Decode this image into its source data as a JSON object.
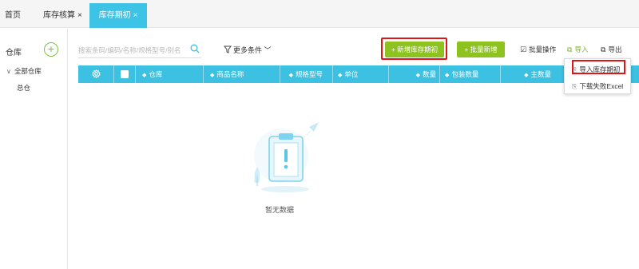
{
  "tabs": [
    {
      "label": "首页"
    },
    {
      "label": "库存核算",
      "close": "×"
    },
    {
      "label": "库存期初",
      "close": "×"
    }
  ],
  "sidebar": {
    "title": "仓库",
    "add_symbol": "+",
    "tree_root": "全部仓库",
    "tree_child": "总仓"
  },
  "toolbar": {
    "search_placeholder": "搜索条码/编码/名称/规格型号/别名",
    "more_filters": "更多条件",
    "add_label": "新增库存期初",
    "batch_add_label": "批量新增",
    "batch_op_label": "批量操作",
    "import_label": "导入",
    "export_label": "导出"
  },
  "table": {
    "columns": [
      "仓库",
      "商品名称",
      "规格型号",
      "单位",
      "数量",
      "包装数量",
      "主数量"
    ]
  },
  "import_menu": {
    "items": [
      "导入库存期初",
      "下载失败Excel"
    ]
  },
  "empty_state": {
    "text": "暂无数据"
  },
  "colors": {
    "accent": "#3dc3e5",
    "green": "#8dc21f",
    "highlight": "#e01515"
  }
}
